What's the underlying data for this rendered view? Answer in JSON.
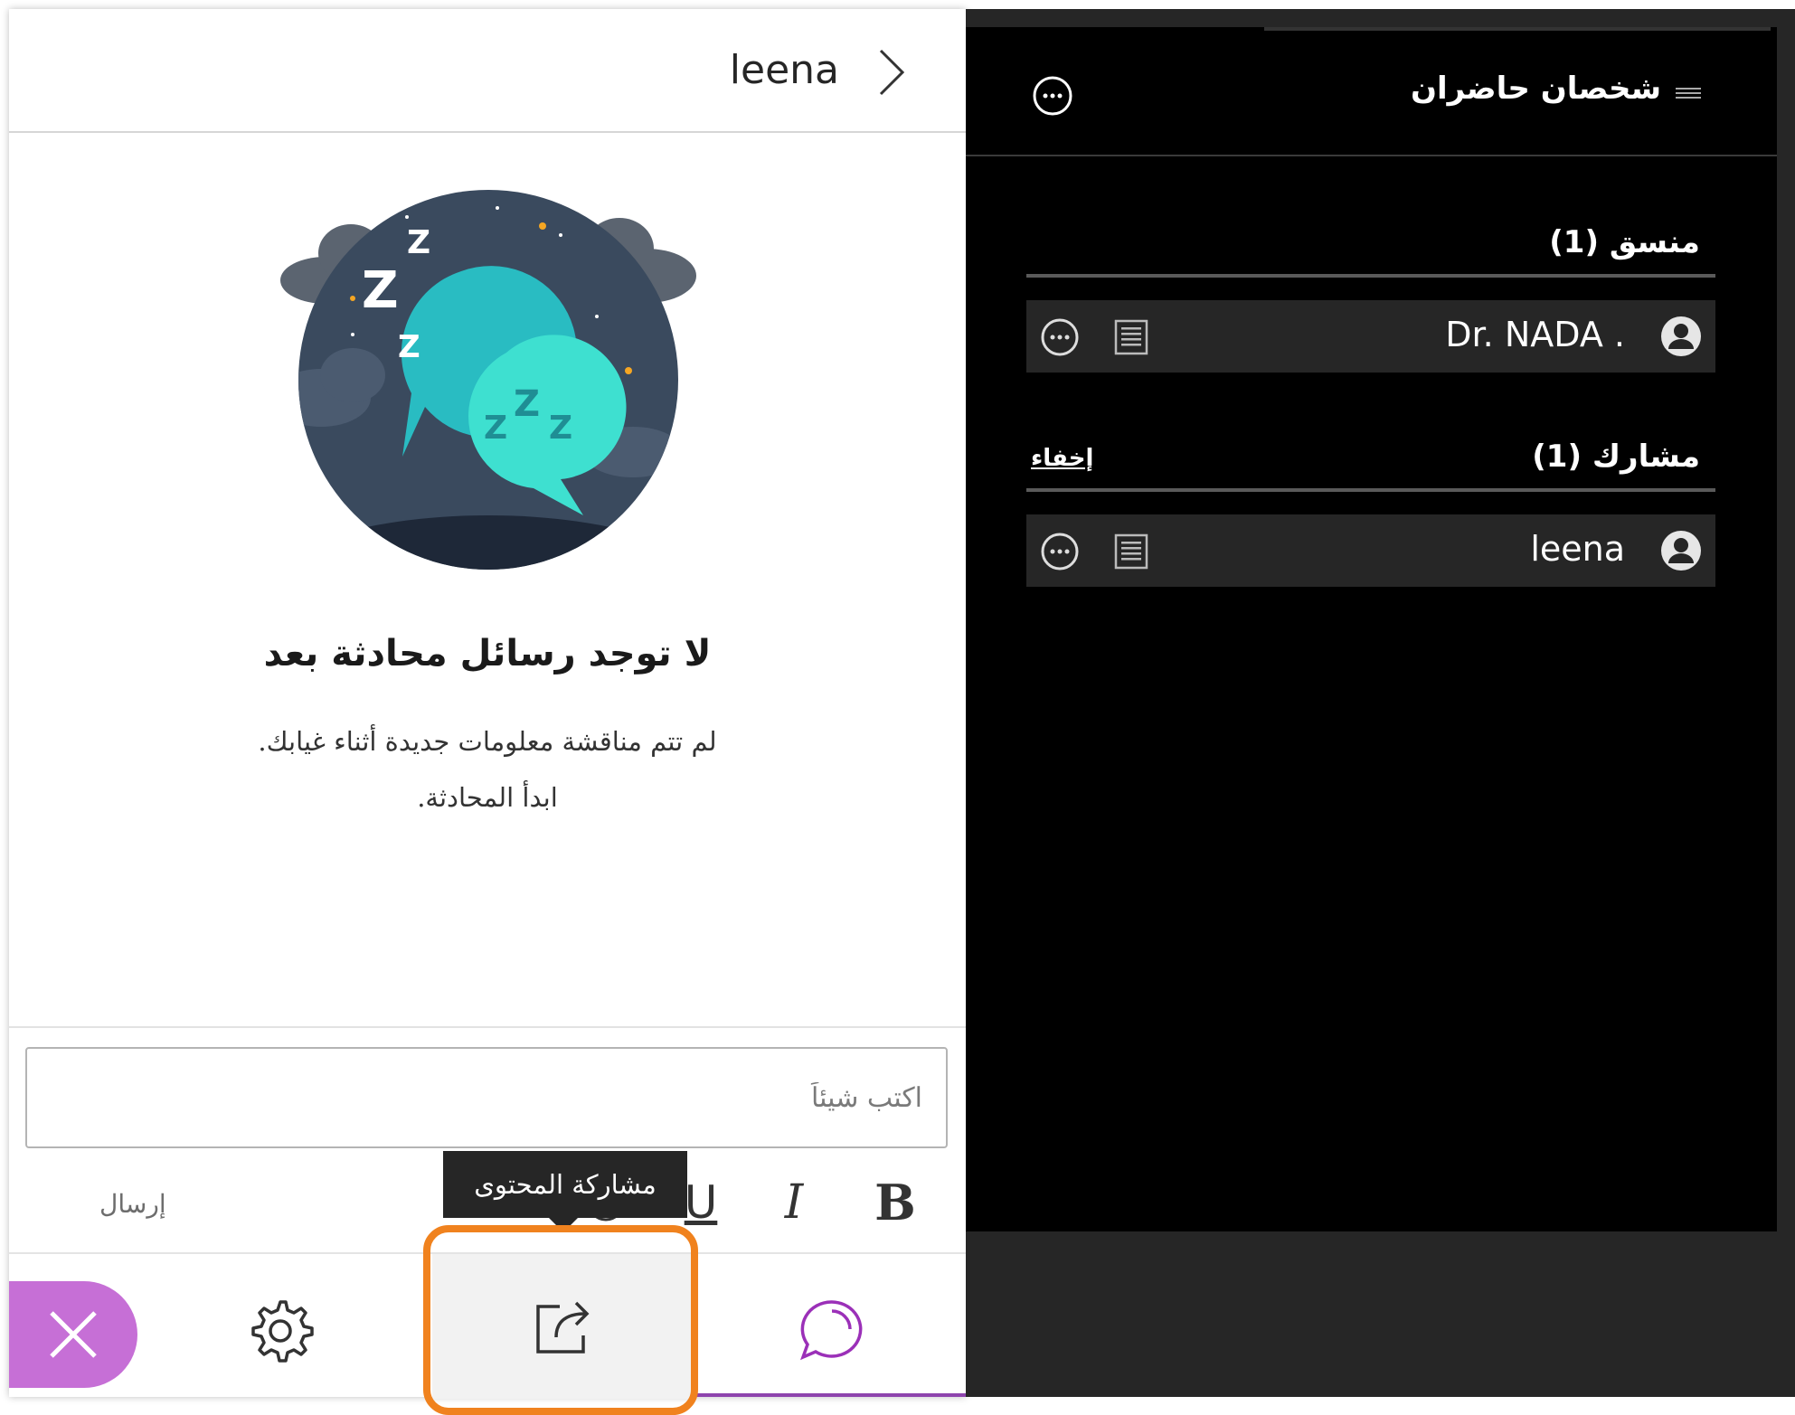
{
  "chat": {
    "header_name": "leena",
    "empty_title": "لا توجد رسائل محادثة بعد",
    "empty_line1": "لم تتم مناقشة معلومات جديدة أثناء غيابك.",
    "empty_line2": "ابدأ المحادثة.",
    "input_placeholder": "اكتب شيئاً",
    "send_label": "إرسال",
    "bold_label": "B",
    "italic_label": "I",
    "underline_label": "U",
    "tooltip": "مشاركة المحتوى"
  },
  "bottom_tabs": {
    "items": [
      {
        "name": "close",
        "icon": "close-icon"
      },
      {
        "name": "settings",
        "icon": "gear-icon"
      },
      {
        "name": "share-content",
        "icon": "share-icon",
        "highlighted": true
      },
      {
        "name": "chat",
        "icon": "chat-bubble-icon",
        "active": true
      }
    ]
  },
  "attendees": {
    "title": "شخصان حاضران",
    "moderator_heading": "منسق (1)",
    "participant_heading": "مشارك (1)",
    "hide_label": "إخفاء",
    "moderators": [
      {
        "name": "Dr. NADA ."
      }
    ],
    "participants": [
      {
        "name": "leena"
      }
    ]
  },
  "colors": {
    "accent_purple": "#c66fd6",
    "active_tab_bar": "#8e44ad",
    "highlight_orange": "#f0821e",
    "illustration_teal": "#2ec4c8"
  }
}
